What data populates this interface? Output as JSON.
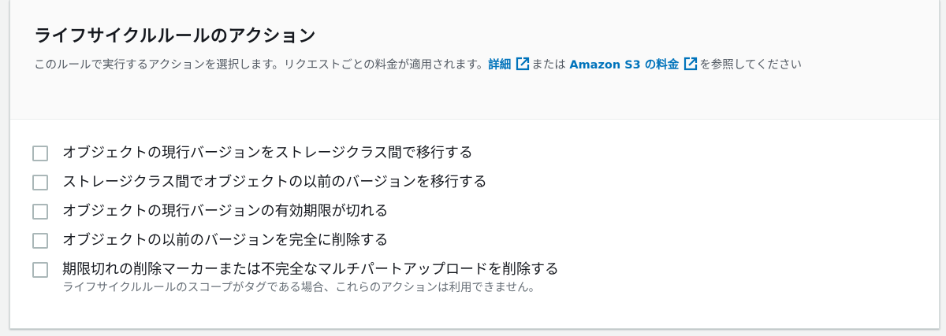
{
  "header": {
    "title": "ライフサイクルルールのアクション",
    "desc_prefix": "このルールで実行するアクションを選択します。リクエストごとの料金が適用されます。",
    "link_details": "詳細",
    "desc_or": "または",
    "link_pricing": "Amazon S3 の料金",
    "desc_suffix": "を参照してください"
  },
  "options": [
    {
      "label": "オブジェクトの現行バージョンをストレージクラス間で移行する",
      "checked": false
    },
    {
      "label": "ストレージクラス間でオブジェクトの以前のバージョンを移行する",
      "checked": false
    },
    {
      "label": "オブジェクトの現行バージョンの有効期限が切れる",
      "checked": false
    },
    {
      "label": "オブジェクトの以前のバージョンを完全に削除する",
      "checked": false
    },
    {
      "label": "期限切れの削除マーカーまたは不完全なマルチパートアップロードを削除する",
      "sublabel": "ライフサイクルルールのスコープがタグである場合、これらのアクションは利用できません。",
      "checked": false
    }
  ],
  "colors": {
    "link": "#0073bb",
    "checkbox_border": "#aab7b8"
  },
  "icons": {
    "external_link": "external-link-icon"
  }
}
